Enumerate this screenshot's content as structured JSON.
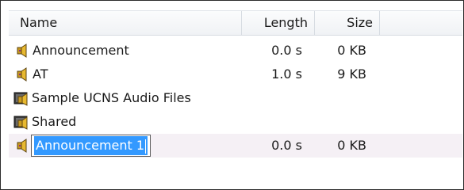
{
  "columns": {
    "name": "Name",
    "length": "Length",
    "size": "Size"
  },
  "rows": [
    {
      "icon": "audio-file-icon",
      "name": "Announcement",
      "length": "0.0 s",
      "size": "0 KB"
    },
    {
      "icon": "audio-file-icon",
      "name": "AT",
      "length": "1.0 s",
      "size": "9 KB"
    },
    {
      "icon": "audio-folder-icon",
      "name": "Sample UCNS Audio Files",
      "length": "",
      "size": ""
    },
    {
      "icon": "audio-folder-icon",
      "name": "Shared",
      "length": "",
      "size": ""
    },
    {
      "icon": "audio-file-icon",
      "name": "Announcement 1",
      "length": "0.0 s",
      "size": "0 KB",
      "editing": true
    }
  ],
  "colors": {
    "selection": "#3399ff",
    "editing_row_bg": "#f5f0f5",
    "header_border": "#d7dce2"
  }
}
